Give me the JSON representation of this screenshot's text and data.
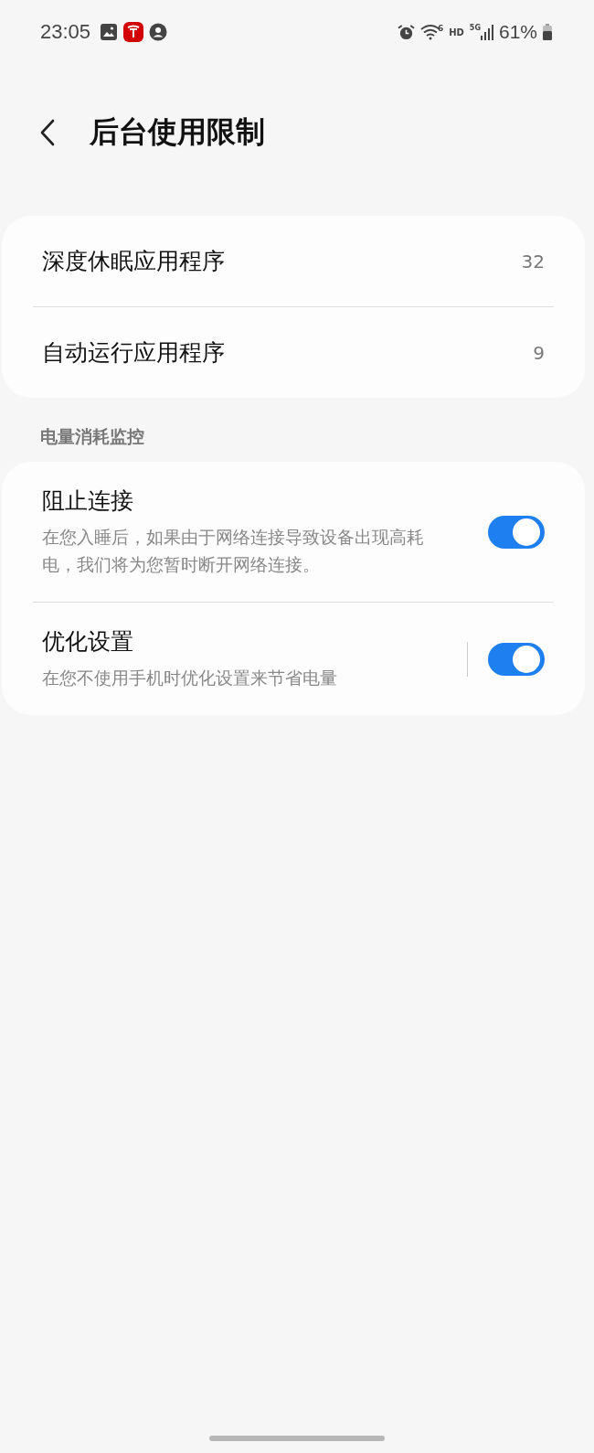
{
  "status_bar": {
    "time": "23:05",
    "wifi_label": "6",
    "hd": "HD",
    "network": "5G",
    "battery": "61%"
  },
  "header": {
    "title": "后台使用限制"
  },
  "app_lists": [
    {
      "label": "深度休眠应用程序",
      "count": "32"
    },
    {
      "label": "自动运行应用程序",
      "count": "9"
    }
  ],
  "section": {
    "title": "电量消耗监控",
    "items": [
      {
        "title": "阻止连接",
        "description": "在您入睡后，如果由于网络连接导致设备出现高耗电，我们将为您暂时断开网络连接。",
        "on": true,
        "separator": false
      },
      {
        "title": "优化设置",
        "description": "在您不使用手机时优化设置来节省电量",
        "on": true,
        "separator": true
      }
    ]
  }
}
